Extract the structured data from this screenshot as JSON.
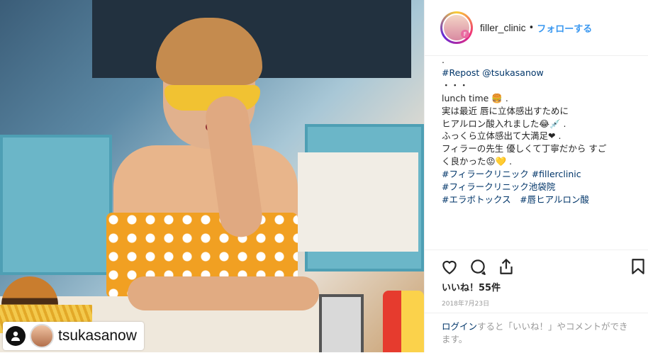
{
  "post": {
    "username": "filler_clinic",
    "separator": "•",
    "follow_label": "フォローする",
    "caption_lines": [
      ".",
      "#Repost @tsukasanow",
      "・・・",
      "lunch time 🍔 .",
      "",
      "実は最近 唇に立体感出すために",
      "ヒアルロン酸入れました😂💉 .",
      "",
      "ふっくら立体感出て大満足❤ .",
      "",
      "フィラーの先生 優しくて丁寧だから すご",
      "く良かった😡💛 .",
      "",
      "#フィラークリニック #fillerclinic",
      "#フィラークリニック池袋院",
      "#エラボトックス　#唇ヒアルロン酸"
    ],
    "likes": "いいね！55件",
    "date": "2018年7月23日",
    "login_link": "ログイン",
    "login_rest": "すると「いいね！」やコメントができます。"
  },
  "photo_tag": {
    "name": "tsukasanow"
  },
  "icons": [
    "heart-icon",
    "comment-icon",
    "share-icon",
    "bookmark-icon",
    "person-tag-icon"
  ],
  "colors": {
    "link": "#3897f0",
    "hashtag": "#003569",
    "muted": "#999999"
  }
}
